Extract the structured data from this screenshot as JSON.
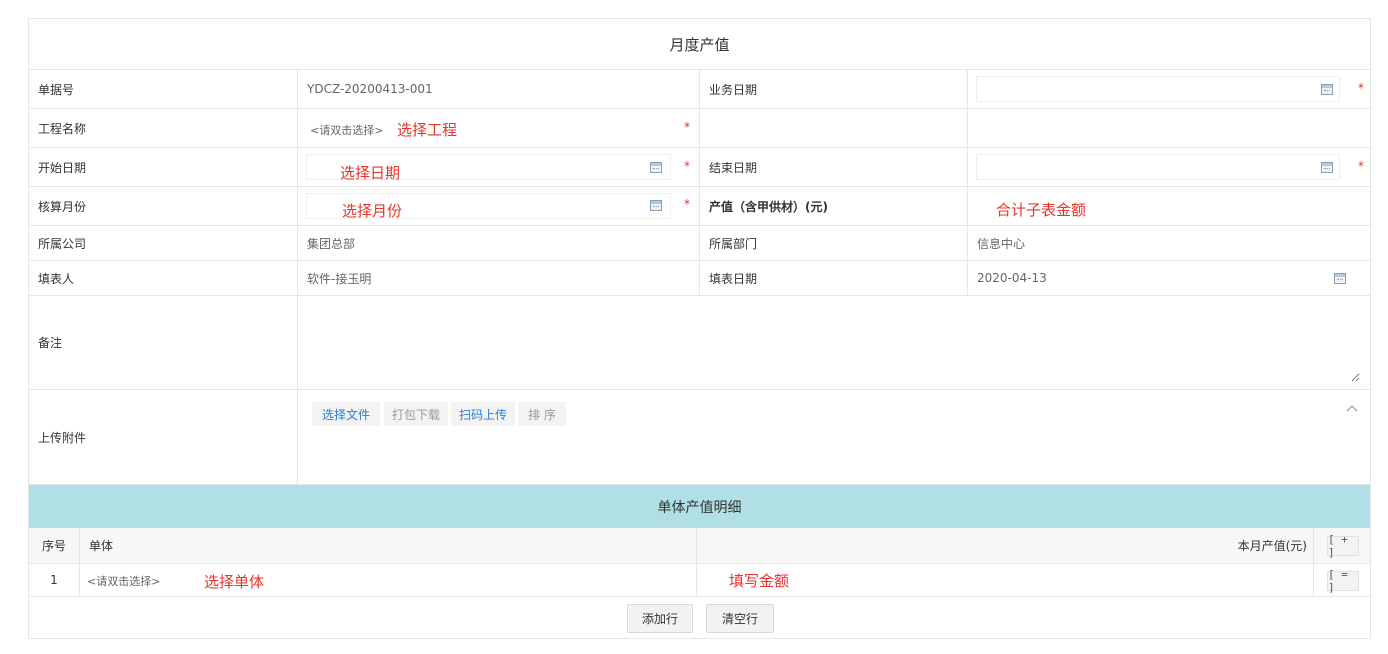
{
  "form_title": "月度产值",
  "fields": {
    "doc_no": {
      "label": "单据号",
      "value": "YDCZ-20200413-001"
    },
    "biz_date": {
      "label": "业务日期",
      "value": ""
    },
    "project": {
      "label": "工程名称",
      "placeholder": "<请双击选择>",
      "annotation": "选择工程"
    },
    "start_date": {
      "label": "开始日期",
      "annotation": "选择日期"
    },
    "end_date": {
      "label": "结束日期"
    },
    "account_month": {
      "label": "核算月份",
      "annotation": "选择月份"
    },
    "output_value": {
      "label": "产值（含甲供材）(元)",
      "annotation": "合计子表金额"
    },
    "company": {
      "label": "所属公司",
      "value": "集团总部"
    },
    "department": {
      "label": "所属部门",
      "value": "信息中心"
    },
    "filler": {
      "label": "填表人",
      "value": "软件-接玉明"
    },
    "fill_date": {
      "label": "填表日期",
      "value": "2020-04-13"
    },
    "remark": {
      "label": "备注",
      "value": ""
    },
    "attachment": {
      "label": "上传附件"
    }
  },
  "required_mark": "*",
  "attachment_toolbar": [
    {
      "label": "选择文件",
      "color": "#2a7fd4"
    },
    {
      "label": "打包下载",
      "color": "#999999"
    },
    {
      "label": "扫码上传",
      "color": "#2a7fd4"
    },
    {
      "label": "排 序",
      "color": "#999999"
    }
  ],
  "detail": {
    "title": "单体产值明细",
    "columns": {
      "seq": "序号",
      "unit": "单体",
      "amount": "本月产值(元)",
      "add": "[ + ]"
    },
    "rows": [
      {
        "seq": "1",
        "unit_placeholder": "<请双击选择>",
        "unit_annotation": "选择单体",
        "amount_annotation": "填写金额",
        "remove": "[ = ]"
      }
    ],
    "buttons": {
      "add_row": "添加行",
      "clear_rows": "清空行"
    }
  },
  "colors": {
    "section_header": "#b0dfe5",
    "annotation_red": "#e8342b",
    "link_blue": "#2a7fd4"
  }
}
